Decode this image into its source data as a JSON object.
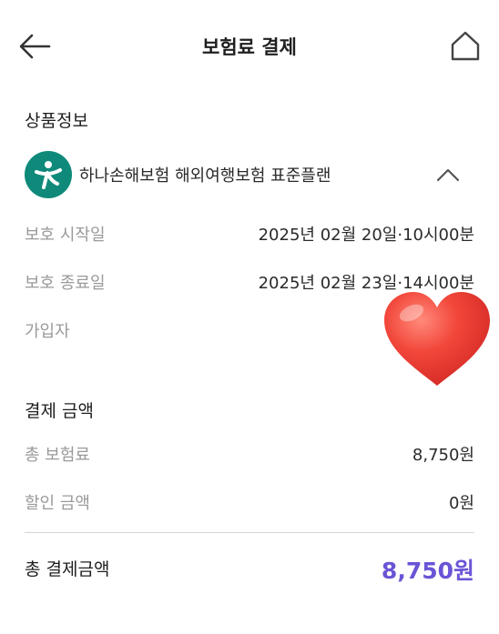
{
  "header": {
    "title": "보험료 결제",
    "back_icon": "arrow-left-icon",
    "home_icon": "home-icon"
  },
  "product_section": {
    "heading": "상품정보",
    "product_name": "하나손해보험 해외여행보험 표준플랜",
    "logo_icon": "hana-insurance-logo",
    "toggle_icon": "chevron-up-icon"
  },
  "coverage": {
    "start_label": "보호 시작일",
    "start_value": "2025년 02월 20일·10시00분",
    "end_label": "보호 종료일",
    "end_value": "2025년 02월 23일·14시00분",
    "subscriber_label": "가입자",
    "subscriber_overlay_icon": "heart-sticker"
  },
  "payment": {
    "heading": "결제 금액",
    "premium_label": "총 보험료",
    "premium_value": "8,750원",
    "discount_label": "할인 금액",
    "discount_value": "0원",
    "total_label": "총 결제금액",
    "total_value": "8,750원"
  },
  "colors": {
    "accent": "#6b54d6",
    "logo_bg": "#0f8a7a",
    "muted_text": "#9a9a9a",
    "heart": "#f0433a"
  }
}
